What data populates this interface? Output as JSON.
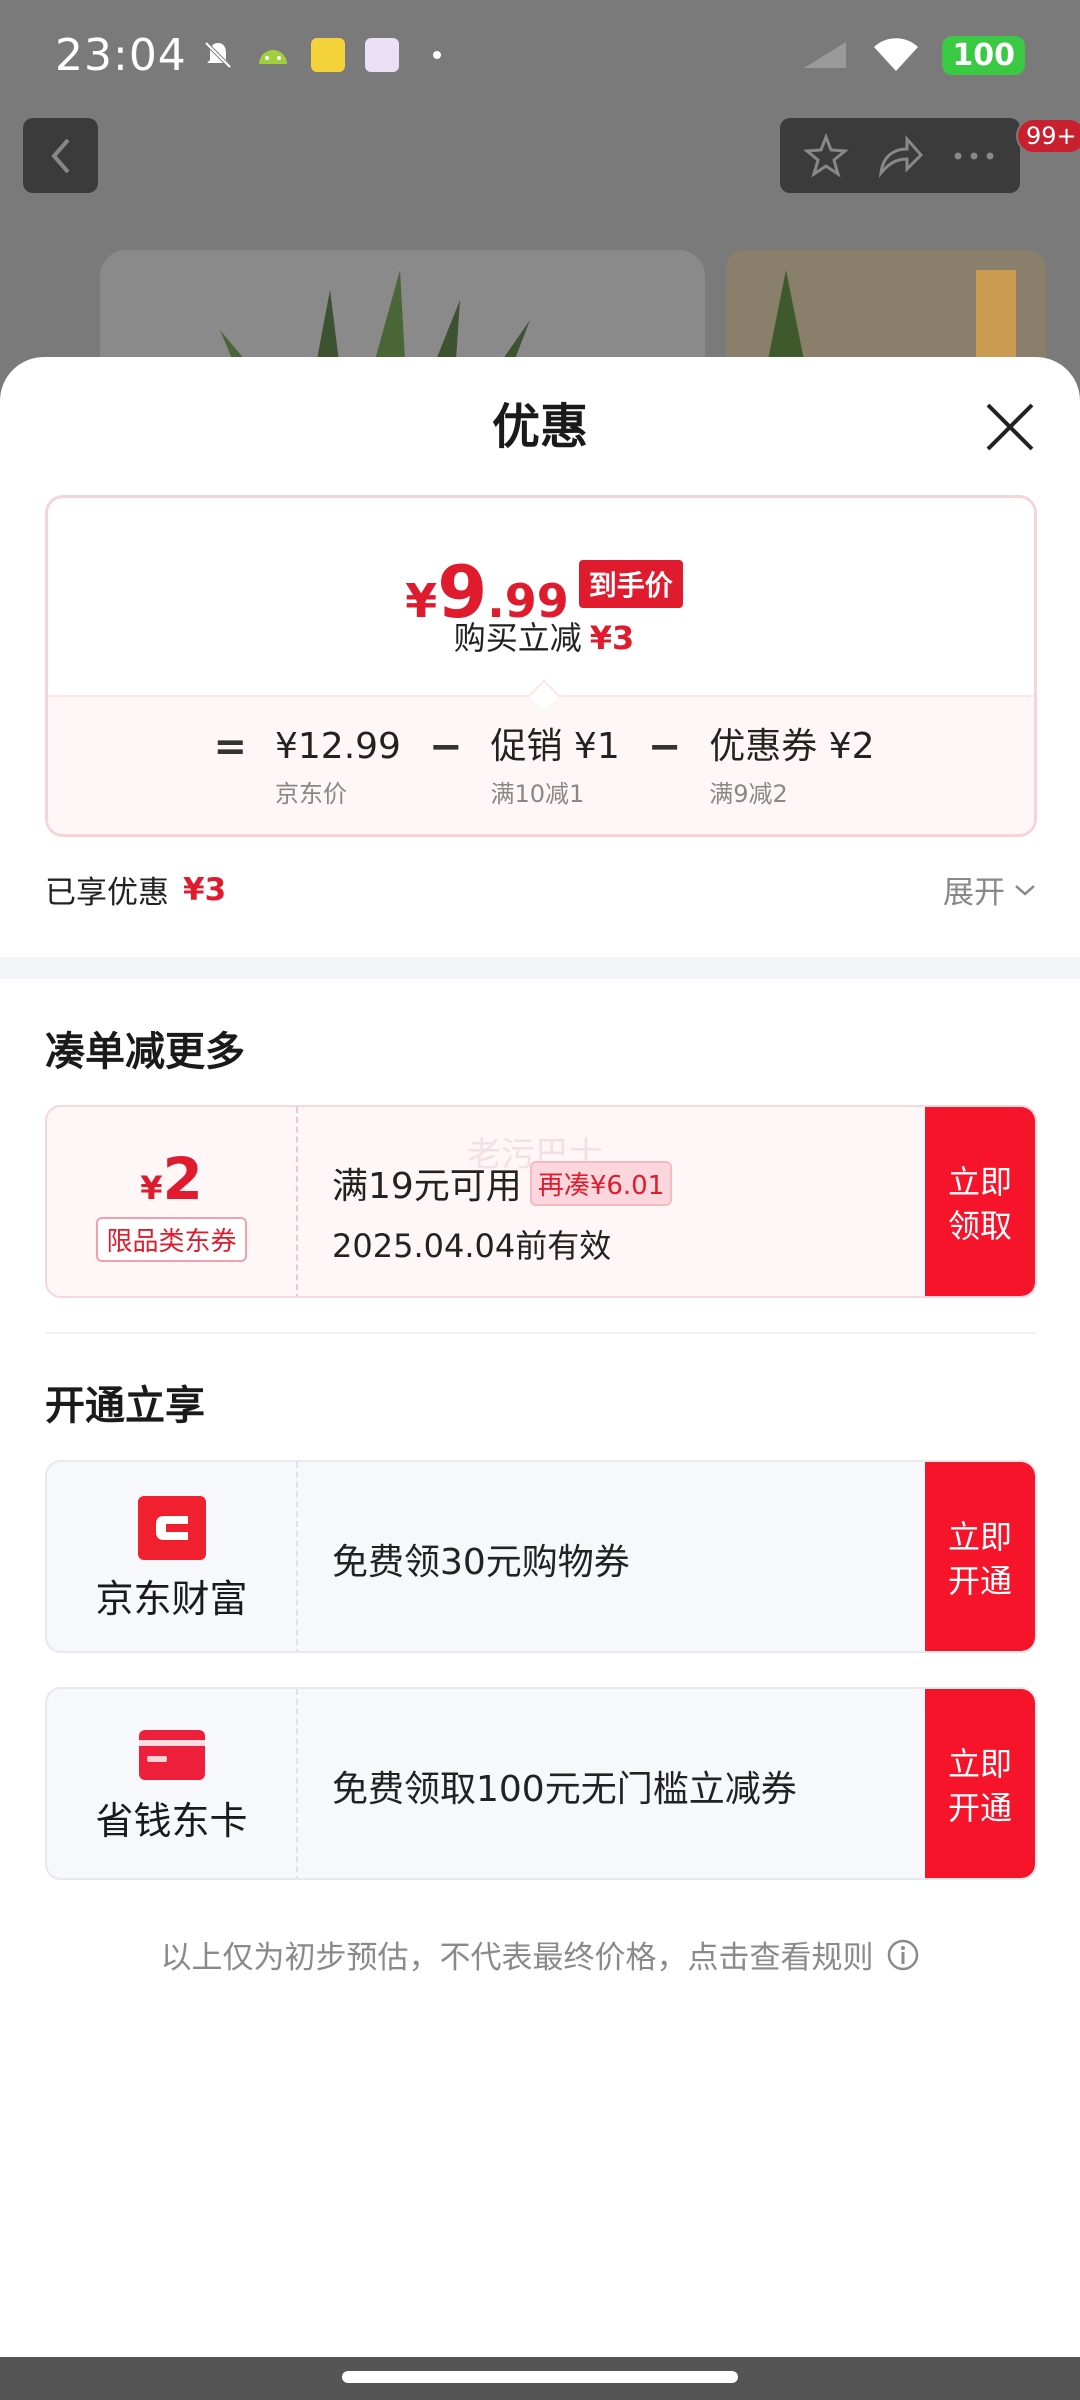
{
  "status_bar": {
    "time": "23:04",
    "battery": "100",
    "icons": [
      "mute-icon",
      "android-icon",
      "app-icon",
      "app-icon-2",
      "dot-icon",
      "signal-icon",
      "wifi-icon",
      "battery-icon"
    ]
  },
  "background_page": {
    "badge": "99+"
  },
  "sheet": {
    "title": "优惠",
    "price": {
      "yen": "¥",
      "integer": "9",
      "decimal": ".99",
      "tag": "到手价",
      "sub_label": "购买立减",
      "sub_value": "¥3"
    },
    "breakdown": {
      "equals": "=",
      "minus": "−",
      "items": [
        {
          "value": "¥12.99",
          "label": "京东价"
        },
        {
          "value": "促销 ¥1",
          "label": "满10减1"
        },
        {
          "value": "优惠券 ¥2",
          "label": "满9减2"
        }
      ]
    },
    "enjoyed": {
      "label": "已享优惠",
      "value": "¥3",
      "expand_label": "展开"
    }
  },
  "more_section": {
    "title": "凑单减更多",
    "coupon": {
      "yen": "¥",
      "amount": "2",
      "tag": "限品类东券",
      "condition": "满19元可用",
      "add_more": "再凑¥6.01",
      "expiry": "2025.04.04前有效",
      "button": "立即领取",
      "watermark": "老污巴士"
    }
  },
  "open_section": {
    "title": "开通立享",
    "services": [
      {
        "name": "京东财富",
        "text": "免费领30元购物券",
        "button": "立即开通"
      },
      {
        "name": "省钱东卡",
        "text": "免费领取100元无门槛立减券",
        "button": "立即开通"
      }
    ]
  },
  "footer": {
    "note": "以上仅为初步预估，不代表最终价格，点击查看规则"
  },
  "colors": {
    "brand_red": "#e01b2d",
    "button_red": "#f5142a",
    "battery_green": "#39c943"
  }
}
